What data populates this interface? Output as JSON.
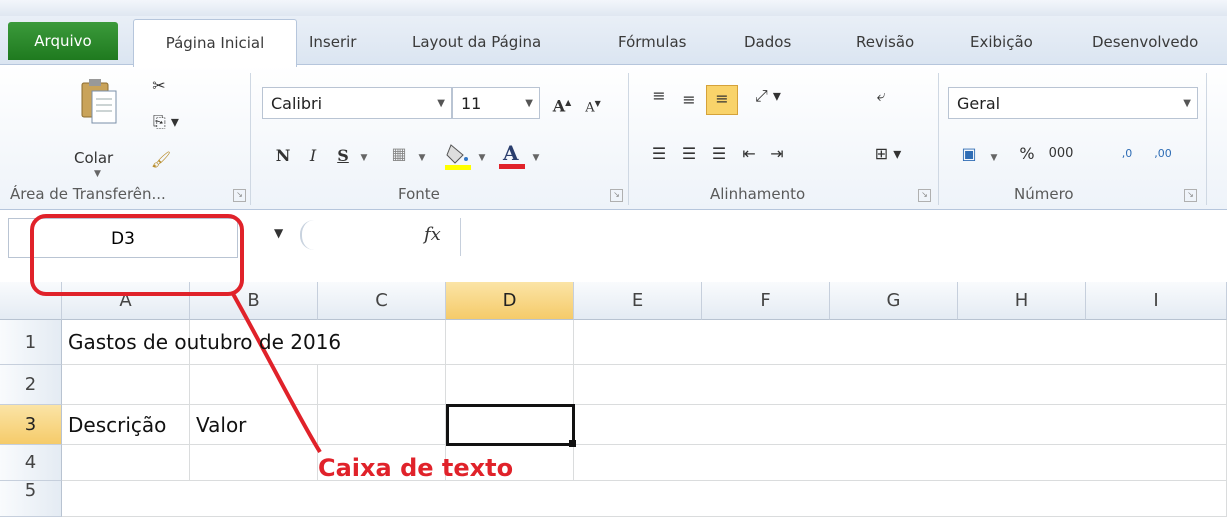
{
  "tabs": {
    "file": "Arquivo",
    "home": "Página Inicial",
    "insert": "Inserir",
    "layout": "Layout da Página",
    "formulas": "Fórmulas",
    "data": "Dados",
    "review": "Revisão",
    "view": "Exibição",
    "developer": "Desenvolvedo"
  },
  "ribbon": {
    "clipboard": {
      "paste_label": "Colar",
      "group_label": "Área de Transferên..."
    },
    "font": {
      "font_name": "Calibri",
      "font_size": "11",
      "group_label": "Fonte",
      "bold": "N",
      "italic": "I",
      "underline": "S"
    },
    "alignment": {
      "group_label": "Alinhamento"
    },
    "number": {
      "format": "Geral",
      "group_label": "Número",
      "percent": "%",
      "thousands": "000",
      "inc_decimal": ",0",
      "dec_decimal": ",00"
    }
  },
  "formula_bar": {
    "name_box": "D3",
    "fx": "fx",
    "formula": ""
  },
  "grid": {
    "columns": [
      "A",
      "B",
      "C",
      "D",
      "E",
      "F",
      "G",
      "H",
      "I"
    ],
    "rows": [
      "1",
      "2",
      "3",
      "4",
      "5"
    ],
    "A1": "Gastos de outubro de 2016",
    "A3": "Descrição",
    "B3": "Valor",
    "selected_column": "D",
    "selected_row": "3"
  },
  "annotation": {
    "label": "Caixa de texto",
    "color": "#e0222a"
  }
}
